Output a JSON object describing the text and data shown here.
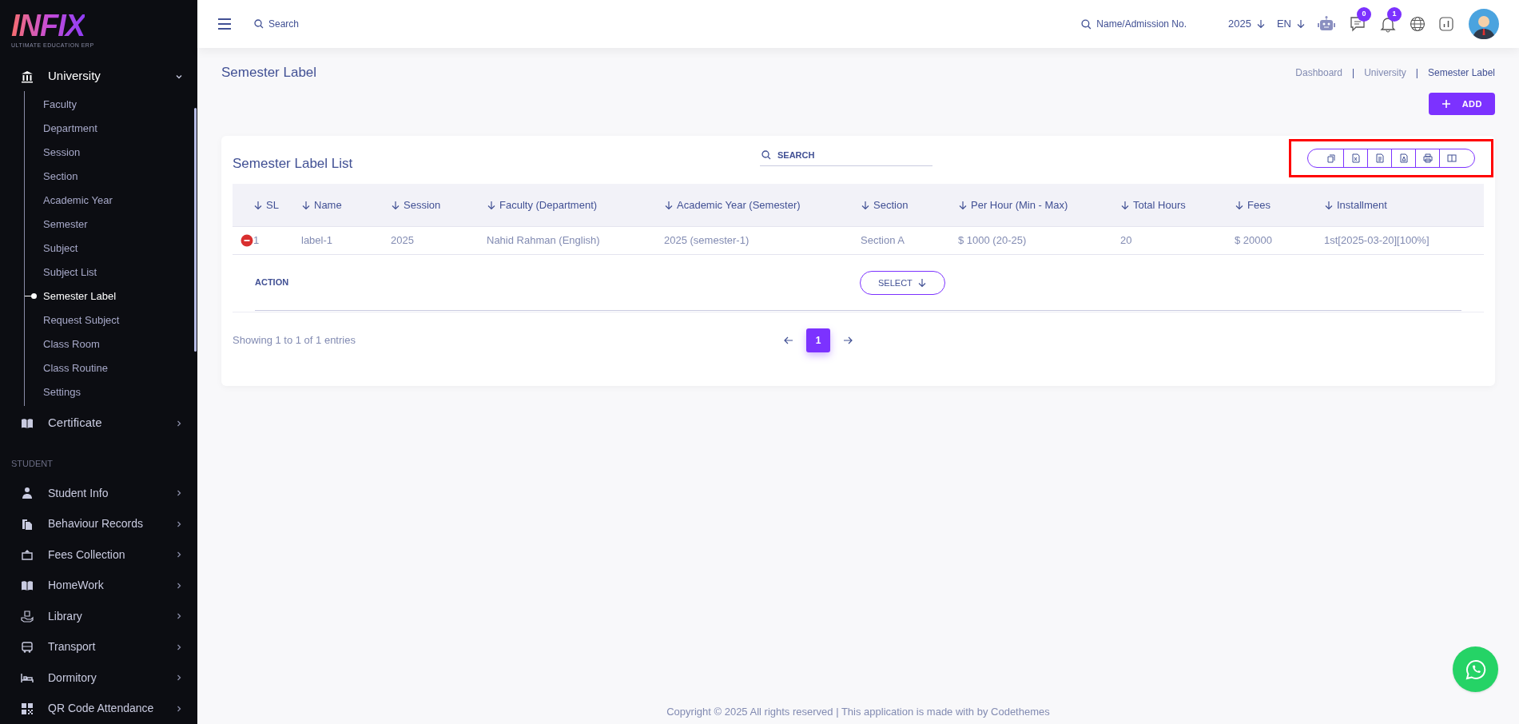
{
  "logo": {
    "wordmark": "INFIX",
    "tagline": "ULTIMATE EDUCATION ERP"
  },
  "sidebar": {
    "groups": [
      {
        "label": "University",
        "kind": "bank",
        "expanded": true,
        "children": [
          {
            "label": "Faculty",
            "selected": false
          },
          {
            "label": "Department",
            "selected": false
          },
          {
            "label": "Session",
            "selected": false
          },
          {
            "label": "Section",
            "selected": false
          },
          {
            "label": "Academic Year",
            "selected": false
          },
          {
            "label": "Semester",
            "selected": false
          },
          {
            "label": "Subject",
            "selected": false
          },
          {
            "label": "Subject List",
            "selected": false
          },
          {
            "label": "Semester Label",
            "selected": true
          },
          {
            "label": "Request Subject",
            "selected": false
          },
          {
            "label": "Class Room",
            "selected": false
          },
          {
            "label": "Class Routine",
            "selected": false
          },
          {
            "label": "Settings",
            "selected": false
          }
        ]
      },
      {
        "label": "Certificate",
        "kind": "book",
        "expanded": false
      }
    ],
    "section_label": "STUDENT",
    "items": [
      {
        "label": "Student Info",
        "kind": "person"
      },
      {
        "label": "Behaviour Records",
        "kind": "copy"
      },
      {
        "label": "Fees Collection",
        "kind": "wallet"
      },
      {
        "label": "HomeWork",
        "kind": "book"
      },
      {
        "label": "Library",
        "kind": "hand"
      },
      {
        "label": "Transport",
        "kind": "bus"
      },
      {
        "label": "Dormitory",
        "kind": "bed"
      },
      {
        "label": "QR Code Attendance",
        "kind": "qr"
      }
    ]
  },
  "topbar": {
    "search": "Search",
    "student_search": "Name/Admission No.",
    "year": "2025",
    "language": "EN",
    "chat_badge": "0",
    "notification_badge": "1"
  },
  "page": {
    "title": "Semester Label",
    "breadcrumb_separator": "|",
    "breadcrumb": [
      {
        "label": "Dashboard",
        "selected": false
      },
      {
        "label": "University",
        "selected": false
      },
      {
        "label": "Semester Label",
        "selected": true
      }
    ],
    "add_button": "ADD"
  },
  "card": {
    "title": "Semester Label List",
    "search_placeholder": "SEARCH",
    "columns": [
      "SL",
      "Name",
      "Session",
      "Faculty (Department)",
      "Academic Year (Semester)",
      "Section",
      "Per Hour (Min - Max)",
      "Total Hours",
      "Fees",
      "Installment"
    ],
    "rows": [
      [
        "1",
        "label-1",
        "2025",
        "Nahid Rahman (English)",
        "2025 (semester-1)",
        "Section A",
        "$ 1000 (20-25)",
        "20",
        "$ 20000",
        "1st[2025-03-20][100%]"
      ]
    ],
    "action_label": "ACTION",
    "select_button": "SELECT",
    "summary": "Showing 1 to 1 of 1 entries",
    "pages": [
      {
        "label": "1",
        "selected": true
      }
    ]
  },
  "footer": "Copyright © 2025 All rights reserved | This application is made with by Codethemes"
}
